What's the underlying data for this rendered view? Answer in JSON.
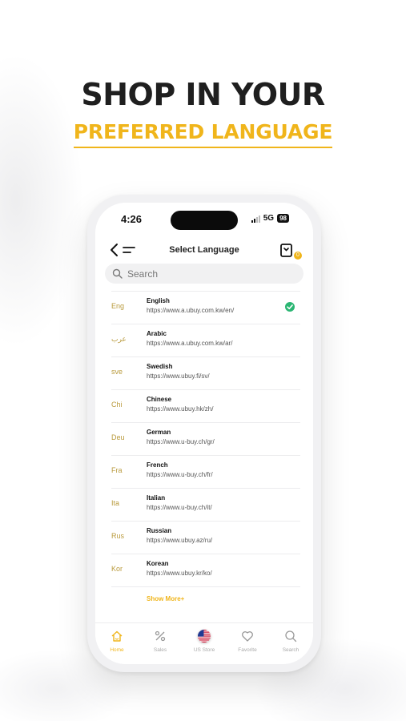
{
  "headline": "SHOP IN YOUR",
  "subheadline": "PREFERRED LANGUAGE",
  "status_bar": {
    "time": "4:26",
    "network": "5G",
    "battery": "98"
  },
  "nav": {
    "title": "Select Language",
    "cart_badge": "0"
  },
  "search": {
    "placeholder": "Search"
  },
  "languages": [
    {
      "abbr": "Eng",
      "name": "English",
      "url": "https://www.a.ubuy.com.kw/en/",
      "selected": true
    },
    {
      "abbr": "عرب",
      "name": "Arabic",
      "url": "https://www.a.ubuy.com.kw/ar/",
      "selected": false
    },
    {
      "abbr": "sve",
      "name": "Swedish",
      "url": "https://www.ubuy.fi/sv/",
      "selected": false
    },
    {
      "abbr": "Chi",
      "name": "Chinese",
      "url": "https://www.ubuy.hk/zh/",
      "selected": false
    },
    {
      "abbr": "Deu",
      "name": "German",
      "url": "https://www.u-buy.ch/gr/",
      "selected": false
    },
    {
      "abbr": "Fra",
      "name": "French",
      "url": "https://www.u-buy.ch/fr/",
      "selected": false
    },
    {
      "abbr": "Ita",
      "name": "Italian",
      "url": "https://www.u-buy.ch/it/",
      "selected": false
    },
    {
      "abbr": "Rus",
      "name": "Russian",
      "url": "https://www.ubuy.az/ru/",
      "selected": false
    },
    {
      "abbr": "Kor",
      "name": "Korean",
      "url": "https://www.ubuy.kr/ko/",
      "selected": false
    }
  ],
  "show_more": "Show More+",
  "tabs": [
    {
      "label": "Home",
      "icon": "home-icon",
      "active": true
    },
    {
      "label": "Sales",
      "icon": "percent-icon",
      "active": false
    },
    {
      "label": "US Store",
      "icon": "us-flag-icon",
      "active": false
    },
    {
      "label": "Favorite",
      "icon": "heart-icon",
      "active": false
    },
    {
      "label": "Search",
      "icon": "search-icon",
      "active": false
    }
  ],
  "colors": {
    "accent": "#f0b51b",
    "check": "#2bb673",
    "text": "#1f1f1f"
  }
}
